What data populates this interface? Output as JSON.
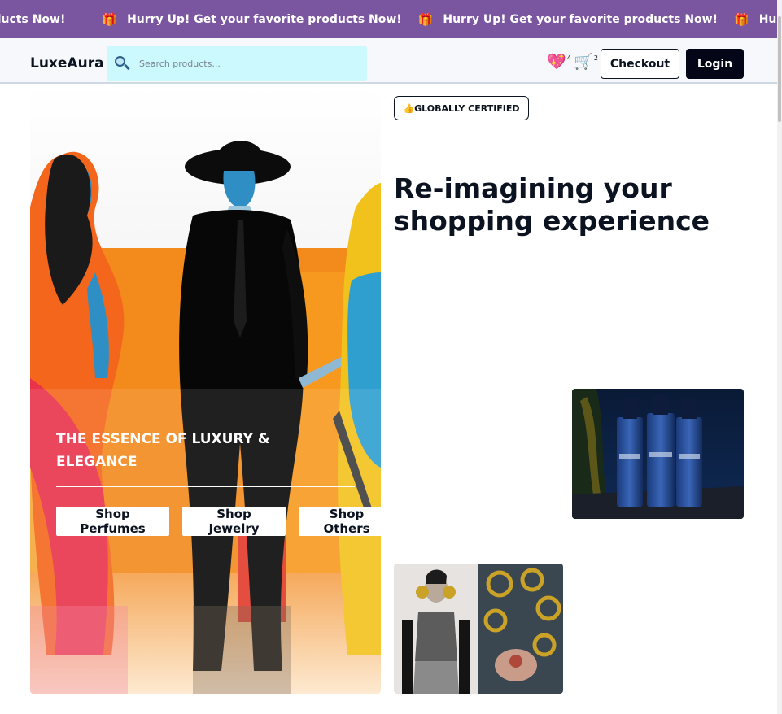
{
  "marquee": {
    "items": [
      "Hurry Up! Get your favorite products Now!",
      "Hurry Up! Get your favorite products Now!",
      "Hurry Up! Get your favorite products Now!",
      "Hurry Up! Get your favorite products Now!"
    ],
    "first_partial": "roducts Now!",
    "gift_icon": "🎁"
  },
  "header": {
    "brand": "LuxeAura",
    "search_placeholder": "Search products...",
    "wishlist_icon": "💖",
    "wishlist_count": "4",
    "cart_icon": "🛒",
    "cart_count": "2",
    "checkout_label": "Checkout",
    "login_label": "Login"
  },
  "hero": {
    "title": "THE ESSENCE OF LUXURY & ELEGANCE",
    "buttons": [
      "Shop Perfumes",
      "Shop Jewelry",
      "Shop Others"
    ]
  },
  "right": {
    "badge": "👍GLOBALLY CERTIFIED",
    "headline": "Re-imagining your shopping experience"
  },
  "colors": {
    "marquee_bg": "#7a55a0",
    "search_bg": "#ccf9fd",
    "login_bg": "#020617"
  }
}
